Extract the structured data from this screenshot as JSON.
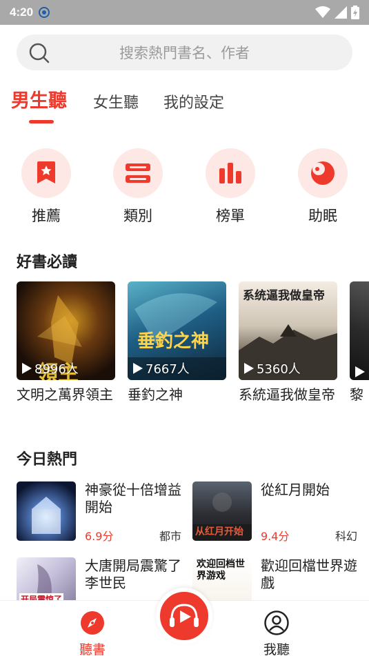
{
  "status": {
    "time": "4:20"
  },
  "search": {
    "placeholder": "搜索熱門書名、作者"
  },
  "tabs": [
    {
      "label": "男生聽",
      "active": true
    },
    {
      "label": "女生聽",
      "active": false
    },
    {
      "label": "我的設定",
      "active": false
    }
  ],
  "quick": [
    {
      "label": "推薦",
      "icon": "star-bookmark-icon"
    },
    {
      "label": "類別",
      "icon": "category-icon"
    },
    {
      "label": "榜單",
      "icon": "ranking-bars-icon"
    },
    {
      "label": "助眠",
      "icon": "moon-sleep-icon"
    }
  ],
  "must_read": {
    "title": "好書必讀",
    "books": [
      {
        "title": "文明之萬界領主",
        "count": "8996人",
        "cover_text": "領主"
      },
      {
        "title": "垂釣之神",
        "count": "7667人",
        "cover_text": "垂釣之神"
      },
      {
        "title": "系統逼我做皇帝",
        "count": "5360人",
        "cover_text": "系统逼我做皇帝"
      },
      {
        "title": "黎",
        "count": "",
        "cover_text": ""
      }
    ]
  },
  "hot": {
    "title": "今日熱門",
    "items": [
      {
        "title": "神豪從十倍增益開始",
        "score": "6.9分",
        "genre": "都市"
      },
      {
        "title": "從紅月開始",
        "score": "9.4分",
        "genre": "科幻",
        "cover_text": "从红月开始"
      },
      {
        "title": "大唐開局震驚了李世民",
        "score": "",
        "genre": "",
        "cover_text": "开局震惊了"
      },
      {
        "title": "歡迎回檔世界遊戲",
        "score": "",
        "genre": "",
        "cover_text": "欢迎回档世界游戏"
      }
    ]
  },
  "nav": {
    "listen": "聽書",
    "me": "我聽"
  },
  "colors": {
    "accent": "#ee3a2c",
    "accent_light": "#fde8e5"
  }
}
